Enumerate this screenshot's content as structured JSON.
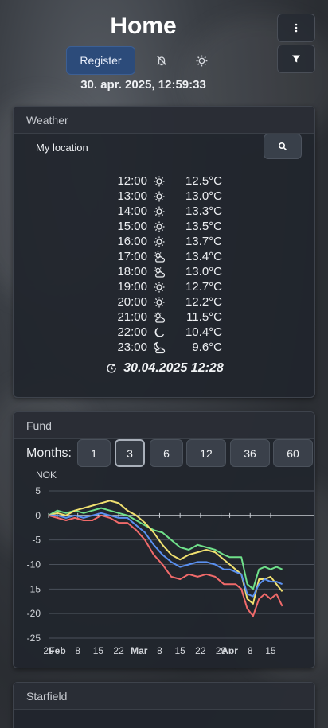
{
  "header": {
    "title": "Home",
    "register_label": "Register",
    "datetime": "30. apr. 2025, 12:59:33"
  },
  "weather": {
    "title": "Weather",
    "location": "My location",
    "forecast": [
      {
        "time": "12:00",
        "icon": "sun-icon",
        "temp": "12.5°C"
      },
      {
        "time": "13:00",
        "icon": "sun-icon",
        "temp": "13.0°C"
      },
      {
        "time": "14:00",
        "icon": "sun-icon",
        "temp": "13.3°C"
      },
      {
        "time": "15:00",
        "icon": "sun-icon",
        "temp": "13.5°C"
      },
      {
        "time": "16:00",
        "icon": "sun-icon",
        "temp": "13.7°C"
      },
      {
        "time": "17:00",
        "icon": "partly-cloudy-icon",
        "temp": "13.4°C"
      },
      {
        "time": "18:00",
        "icon": "partly-cloudy-icon",
        "temp": "13.0°C"
      },
      {
        "time": "19:00",
        "icon": "sun-icon",
        "temp": "12.7°C"
      },
      {
        "time": "20:00",
        "icon": "sun-icon",
        "temp": "12.2°C"
      },
      {
        "time": "21:00",
        "icon": "partly-cloudy-icon",
        "temp": "11.5°C"
      },
      {
        "time": "22:00",
        "icon": "moon-icon",
        "temp": "10.4°C"
      },
      {
        "time": "23:00",
        "icon": "moon-cloud-icon",
        "temp": "9.6°C"
      }
    ],
    "updated": "30.04.2025 12:28"
  },
  "fund": {
    "title": "Fund",
    "months_label": "Months:",
    "month_options": [
      "1",
      "3",
      "6",
      "12",
      "36",
      "60"
    ],
    "selected_month": "3",
    "unit": "NOK"
  },
  "chart_data": {
    "type": "line",
    "ylabel": "NOK",
    "ylim": [
      -25,
      5
    ],
    "yticks": [
      5,
      0,
      -5,
      -10,
      -15,
      -20,
      -25
    ],
    "xlim": [
      0,
      91
    ],
    "xticks": [
      {
        "x": 0,
        "label": "29",
        "bold": false
      },
      {
        "x": 3,
        "label": "Feb",
        "bold": true
      },
      {
        "x": 10,
        "label": "8",
        "bold": false
      },
      {
        "x": 17,
        "label": "15",
        "bold": false
      },
      {
        "x": 24,
        "label": "22",
        "bold": false
      },
      {
        "x": 31,
        "label": "Mar",
        "bold": true
      },
      {
        "x": 38,
        "label": "8",
        "bold": false
      },
      {
        "x": 45,
        "label": "15",
        "bold": false
      },
      {
        "x": 52,
        "label": "22",
        "bold": false
      },
      {
        "x": 59,
        "label": "29",
        "bold": false
      },
      {
        "x": 62,
        "label": "Apr",
        "bold": true
      },
      {
        "x": 69,
        "label": "8",
        "bold": false
      },
      {
        "x": 76,
        "label": "15",
        "bold": false
      }
    ],
    "grid": true,
    "series": [
      {
        "color": "#6fe08a",
        "x": [
          0,
          3,
          6,
          9,
          12,
          15,
          18,
          21,
          24,
          27,
          30,
          33,
          36,
          39,
          42,
          45,
          48,
          51,
          54,
          57,
          60,
          62,
          64,
          66,
          68,
          70,
          72,
          74,
          76,
          78,
          80
        ],
        "values": [
          0,
          1,
          0.5,
          1,
          0.5,
          1,
          1.5,
          1,
          0.5,
          0,
          -1,
          -2,
          -3,
          -3.5,
          -5,
          -6.5,
          -7,
          -6,
          -6.5,
          -7,
          -8,
          -8.5,
          -8.5,
          -8.5,
          -14,
          -15,
          -11,
          -10.5,
          -11,
          -10.5,
          -11
        ]
      },
      {
        "color": "#f0e070",
        "x": [
          0,
          3,
          6,
          9,
          12,
          15,
          18,
          21,
          24,
          27,
          30,
          33,
          36,
          39,
          42,
          45,
          48,
          51,
          54,
          57,
          60,
          62,
          64,
          66,
          68,
          70,
          72,
          74,
          76,
          78,
          80
        ],
        "values": [
          0,
          0.5,
          0,
          1,
          1.5,
          2,
          2.5,
          3,
          2.5,
          1,
          0,
          -1.5,
          -3.5,
          -6,
          -8,
          -9,
          -8,
          -7.5,
          -7,
          -7.5,
          -9,
          -10,
          -11,
          -12,
          -17,
          -18,
          -13,
          -13,
          -12.5,
          -14,
          -15.5
        ]
      },
      {
        "color": "#5a90f0",
        "x": [
          0,
          3,
          6,
          9,
          12,
          15,
          18,
          21,
          24,
          27,
          30,
          33,
          36,
          39,
          42,
          45,
          48,
          51,
          54,
          57,
          60,
          62,
          64,
          66,
          68,
          70,
          72,
          74,
          76,
          78,
          80
        ],
        "values": [
          0,
          0,
          -0.5,
          0,
          -0.5,
          0,
          0.5,
          0,
          -0.5,
          -0.5,
          -2,
          -3.5,
          -6,
          -8,
          -9.5,
          -10.5,
          -10,
          -9.5,
          -9.5,
          -10,
          -11,
          -11,
          -11.5,
          -12,
          -16,
          -16.5,
          -14,
          -13,
          -13.5,
          -13.5,
          -14
        ]
      },
      {
        "color": "#f06a6a",
        "x": [
          0,
          3,
          6,
          9,
          12,
          15,
          18,
          21,
          24,
          27,
          30,
          33,
          36,
          39,
          42,
          45,
          48,
          51,
          54,
          57,
          60,
          62,
          64,
          66,
          68,
          70,
          72,
          74,
          76,
          78,
          80
        ],
        "values": [
          0,
          -0.5,
          -1,
          -0.5,
          -1,
          -1,
          0,
          -0.5,
          -1.5,
          -1.5,
          -3,
          -5,
          -8,
          -10,
          -12.5,
          -13,
          -12,
          -12.5,
          -12,
          -12.5,
          -14,
          -14,
          -14,
          -15,
          -19,
          -20.5,
          -17,
          -16,
          -17,
          -16,
          -18.5
        ]
      }
    ]
  },
  "starfield": {
    "title": "Starfield"
  }
}
